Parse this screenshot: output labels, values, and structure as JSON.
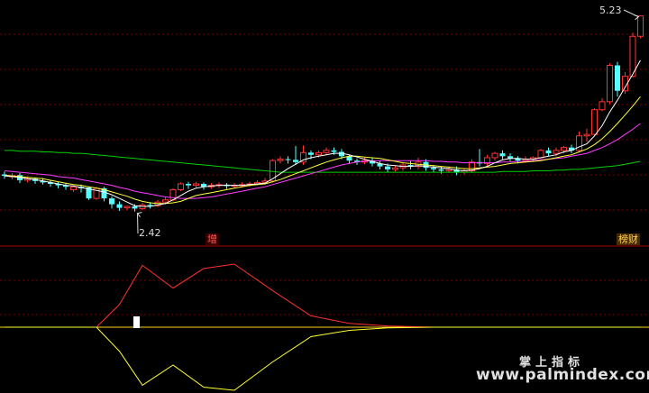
{
  "labels": {
    "high": "5.23",
    "low": "2.42",
    "tag_left": "增",
    "tag_right": "榜财"
  },
  "watermark": {
    "cn": "掌上指标",
    "url": "www.palmindex.com"
  },
  "colors": {
    "up": "#ff3232",
    "down": "#54ffff",
    "ma5": "#ffffff",
    "ma10": "#ffff3c",
    "ma20": "#ff3cff",
    "ma60": "#00d000",
    "ind_up": "#ff3030",
    "ind_down": "#ffff30",
    "ind_base": "#ffd21e"
  },
  "chart_data": [
    {
      "type": "candlestick",
      "title": "",
      "y_annotations": {
        "max": 5.23,
        "min": 2.42
      },
      "ylim": [
        2.3,
        5.35
      ],
      "candles": [
        [
          3.05,
          3.03,
          3.09,
          2.99
        ],
        [
          3.03,
          3.03,
          3.07,
          2.98
        ],
        [
          3.04,
          2.97,
          3.07,
          2.93
        ],
        [
          2.97,
          2.99,
          3.02,
          2.94
        ],
        [
          2.99,
          2.96,
          3.01,
          2.92
        ],
        [
          2.96,
          2.94,
          3.0,
          2.91
        ],
        [
          2.94,
          2.92,
          2.97,
          2.88
        ],
        [
          2.92,
          2.9,
          2.95,
          2.86
        ],
        [
          2.9,
          2.88,
          2.93,
          2.84
        ],
        [
          2.84,
          2.88,
          2.9,
          2.81
        ],
        [
          2.88,
          2.86,
          2.91,
          2.8
        ],
        [
          2.87,
          2.72,
          2.88,
          2.7
        ],
        [
          2.72,
          2.86,
          2.88,
          2.7
        ],
        [
          2.86,
          2.72,
          2.88,
          2.68
        ],
        [
          2.72,
          2.64,
          2.75,
          2.58
        ],
        [
          2.64,
          2.59,
          2.68,
          2.55
        ],
        [
          2.59,
          2.61,
          2.62,
          2.56
        ],
        [
          2.61,
          2.58,
          2.64,
          2.54
        ],
        [
          2.58,
          2.63,
          2.66,
          2.56
        ],
        [
          2.63,
          2.62,
          2.67,
          2.58
        ],
        [
          2.62,
          2.67,
          2.7,
          2.6
        ],
        [
          2.67,
          2.7,
          2.74,
          2.64
        ],
        [
          2.7,
          2.84,
          2.86,
          2.68
        ],
        [
          2.84,
          2.92,
          2.94,
          2.82
        ],
        [
          2.92,
          2.9,
          2.95,
          2.85
        ],
        [
          2.9,
          2.92,
          2.95,
          2.86
        ],
        [
          2.92,
          2.88,
          2.94,
          2.84
        ],
        [
          2.88,
          2.9,
          2.93,
          2.85
        ],
        [
          2.9,
          2.91,
          2.94,
          2.86
        ],
        [
          2.91,
          2.89,
          2.93,
          2.85
        ],
        [
          2.89,
          2.9,
          2.93,
          2.86
        ],
        [
          2.9,
          2.91,
          2.94,
          2.87
        ],
        [
          2.91,
          2.92,
          2.95,
          2.88
        ],
        [
          2.92,
          2.94,
          2.97,
          2.9
        ],
        [
          2.94,
          2.96,
          3.0,
          2.91
        ],
        [
          2.96,
          3.24,
          3.26,
          2.94
        ],
        [
          3.24,
          3.26,
          3.3,
          3.2
        ],
        [
          3.26,
          3.25,
          3.3,
          3.2
        ],
        [
          3.25,
          3.22,
          3.44,
          3.18
        ],
        [
          3.22,
          3.35,
          3.45,
          3.18
        ],
        [
          3.35,
          3.32,
          3.38,
          3.26
        ],
        [
          3.32,
          3.35,
          3.38,
          3.28
        ],
        [
          3.35,
          3.38,
          3.42,
          3.32
        ],
        [
          3.38,
          3.36,
          3.42,
          3.32
        ],
        [
          3.36,
          3.3,
          3.4,
          3.26
        ],
        [
          3.3,
          3.24,
          3.32,
          3.2
        ],
        [
          3.24,
          3.22,
          3.27,
          3.18
        ],
        [
          3.22,
          3.24,
          3.28,
          3.19
        ],
        [
          3.24,
          3.2,
          3.28,
          3.16
        ],
        [
          3.2,
          3.16,
          3.24,
          3.12
        ],
        [
          3.16,
          3.12,
          3.2,
          3.08
        ],
        [
          3.12,
          3.14,
          3.18,
          3.09
        ],
        [
          3.14,
          3.18,
          3.22,
          3.1
        ],
        [
          3.18,
          3.16,
          3.24,
          3.12
        ],
        [
          3.16,
          3.22,
          3.28,
          3.12
        ],
        [
          3.22,
          3.14,
          3.26,
          3.1
        ],
        [
          3.14,
          3.12,
          3.18,
          3.08
        ],
        [
          3.12,
          3.1,
          3.16,
          3.06
        ],
        [
          3.1,
          3.12,
          3.16,
          3.07
        ],
        [
          3.12,
          3.08,
          3.16,
          3.04
        ],
        [
          3.08,
          3.1,
          3.14,
          3.05
        ],
        [
          3.1,
          3.22,
          3.26,
          3.07
        ],
        [
          3.22,
          3.2,
          3.4,
          3.16
        ],
        [
          3.2,
          3.28,
          3.32,
          3.16
        ],
        [
          3.28,
          3.34,
          3.36,
          3.24
        ],
        [
          3.34,
          3.3,
          3.38,
          3.26
        ],
        [
          3.3,
          3.27,
          3.34,
          3.23
        ],
        [
          3.27,
          3.24,
          3.3,
          3.2
        ],
        [
          3.24,
          3.26,
          3.3,
          3.21
        ],
        [
          3.26,
          3.28,
          3.3,
          3.22
        ],
        [
          3.28,
          3.38,
          3.4,
          3.26
        ],
        [
          3.38,
          3.34,
          3.42,
          3.3
        ],
        [
          3.34,
          3.38,
          3.42,
          3.3
        ],
        [
          3.38,
          3.42,
          3.44,
          3.34
        ],
        [
          3.42,
          3.38,
          3.46,
          3.34
        ],
        [
          3.38,
          3.58,
          3.64,
          3.36
        ],
        [
          3.58,
          3.6,
          3.68,
          3.5
        ],
        [
          3.6,
          3.94,
          3.96,
          3.58
        ],
        [
          3.94,
          4.05,
          4.1,
          3.92
        ],
        [
          4.05,
          4.55,
          4.58,
          4.02
        ],
        [
          4.55,
          4.2,
          4.6,
          4.12
        ],
        [
          4.2,
          4.4,
          4.46,
          4.16
        ],
        [
          4.4,
          4.95,
          5.0,
          4.38
        ],
        [
          4.95,
          5.23,
          5.23,
          4.92
        ]
      ],
      "ma5": [
        3.03,
        3.02,
        3.01,
        2.99,
        2.98,
        2.96,
        2.94,
        2.92,
        2.9,
        2.89,
        2.87,
        2.85,
        2.83,
        2.81,
        2.77,
        2.72,
        2.67,
        2.62,
        2.61,
        2.61,
        2.63,
        2.65,
        2.7,
        2.76,
        2.82,
        2.86,
        2.88,
        2.89,
        2.9,
        2.9,
        2.9,
        2.9,
        2.91,
        2.92,
        2.93,
        2.99,
        3.06,
        3.13,
        3.19,
        3.25,
        3.28,
        3.3,
        3.32,
        3.34,
        3.34,
        3.32,
        3.29,
        3.26,
        3.23,
        3.2,
        3.18,
        3.17,
        3.16,
        3.16,
        3.17,
        3.16,
        3.15,
        3.14,
        3.13,
        3.11,
        3.1,
        3.11,
        3.13,
        3.16,
        3.21,
        3.25,
        3.27,
        3.27,
        3.26,
        3.26,
        3.28,
        3.3,
        3.32,
        3.36,
        3.38,
        3.43,
        3.47,
        3.58,
        3.72,
        3.91,
        4.07,
        4.25,
        4.43,
        4.62
      ],
      "ma10": [
        3.04,
        3.03,
        3.02,
        3.01,
        3.0,
        2.99,
        2.97,
        2.95,
        2.93,
        2.91,
        2.9,
        2.88,
        2.86,
        2.84,
        2.81,
        2.78,
        2.75,
        2.71,
        2.68,
        2.66,
        2.65,
        2.65,
        2.66,
        2.68,
        2.72,
        2.76,
        2.78,
        2.8,
        2.82,
        2.84,
        2.86,
        2.88,
        2.9,
        2.91,
        2.92,
        2.95,
        2.98,
        3.02,
        3.06,
        3.1,
        3.14,
        3.18,
        3.22,
        3.25,
        3.28,
        3.3,
        3.3,
        3.29,
        3.28,
        3.27,
        3.25,
        3.23,
        3.21,
        3.2,
        3.19,
        3.18,
        3.17,
        3.16,
        3.15,
        3.14,
        3.13,
        3.13,
        3.14,
        3.15,
        3.16,
        3.18,
        3.2,
        3.21,
        3.22,
        3.23,
        3.24,
        3.26,
        3.28,
        3.3,
        3.32,
        3.36,
        3.4,
        3.46,
        3.54,
        3.64,
        3.75,
        3.87,
        3.99,
        4.12
      ],
      "ma20": [
        3.1,
        3.09,
        3.08,
        3.07,
        3.06,
        3.05,
        3.04,
        3.02,
        3.01,
        3.0,
        2.98,
        2.96,
        2.94,
        2.92,
        2.9,
        2.87,
        2.85,
        2.82,
        2.8,
        2.78,
        2.76,
        2.74,
        2.73,
        2.72,
        2.72,
        2.72,
        2.73,
        2.74,
        2.76,
        2.78,
        2.8,
        2.82,
        2.84,
        2.86,
        2.88,
        2.91,
        2.94,
        2.97,
        3.0,
        3.03,
        3.06,
        3.09,
        3.12,
        3.15,
        3.18,
        3.2,
        3.22,
        3.23,
        3.24,
        3.24,
        3.24,
        3.24,
        3.24,
        3.24,
        3.24,
        3.24,
        3.23,
        3.23,
        3.22,
        3.22,
        3.21,
        3.21,
        3.21,
        3.21,
        3.21,
        3.22,
        3.22,
        3.23,
        3.23,
        3.24,
        3.25,
        3.26,
        3.27,
        3.28,
        3.3,
        3.32,
        3.34,
        3.38,
        3.42,
        3.47,
        3.53,
        3.6,
        3.67,
        3.75
      ],
      "ma60": [
        3.38,
        3.38,
        3.37,
        3.37,
        3.37,
        3.36,
        3.36,
        3.35,
        3.35,
        3.34,
        3.34,
        3.33,
        3.32,
        3.31,
        3.3,
        3.29,
        3.28,
        3.27,
        3.26,
        3.25,
        3.24,
        3.23,
        3.22,
        3.21,
        3.2,
        3.19,
        3.18,
        3.17,
        3.16,
        3.15,
        3.14,
        3.13,
        3.12,
        3.11,
        3.1,
        3.09,
        3.08,
        3.08,
        3.08,
        3.08,
        3.08,
        3.08,
        3.08,
        3.08,
        3.08,
        3.08,
        3.08,
        3.08,
        3.08,
        3.08,
        3.08,
        3.08,
        3.08,
        3.08,
        3.08,
        3.08,
        3.08,
        3.08,
        3.08,
        3.08,
        3.08,
        3.08,
        3.08,
        3.08,
        3.08,
        3.09,
        3.09,
        3.09,
        3.09,
        3.1,
        3.1,
        3.1,
        3.11,
        3.11,
        3.12,
        3.12,
        3.13,
        3.14,
        3.15,
        3.16,
        3.17,
        3.19,
        3.21,
        3.23
      ]
    },
    {
      "type": "line",
      "title": "",
      "ylim": [
        -1,
        1
      ],
      "x": [
        0,
        4,
        7,
        10,
        12,
        15,
        18,
        22,
        26,
        30,
        35,
        40,
        45,
        50,
        56,
        60,
        63,
        66,
        70,
        74,
        78,
        83
      ],
      "upper": [
        0,
        0,
        0,
        0,
        0,
        0.36,
        0.98,
        0.62,
        0.93,
        1.0,
        0.58,
        0.18,
        0.06,
        0.02,
        0,
        0,
        0,
        0,
        0,
        0,
        0,
        0
      ],
      "lower": [
        0,
        0,
        0,
        0,
        0,
        -0.38,
        -0.92,
        -0.6,
        -0.95,
        -1.0,
        -0.55,
        -0.15,
        -0.05,
        -0.01,
        0,
        0,
        0,
        0,
        0,
        0,
        0,
        0
      ],
      "baseline": 0
    }
  ]
}
